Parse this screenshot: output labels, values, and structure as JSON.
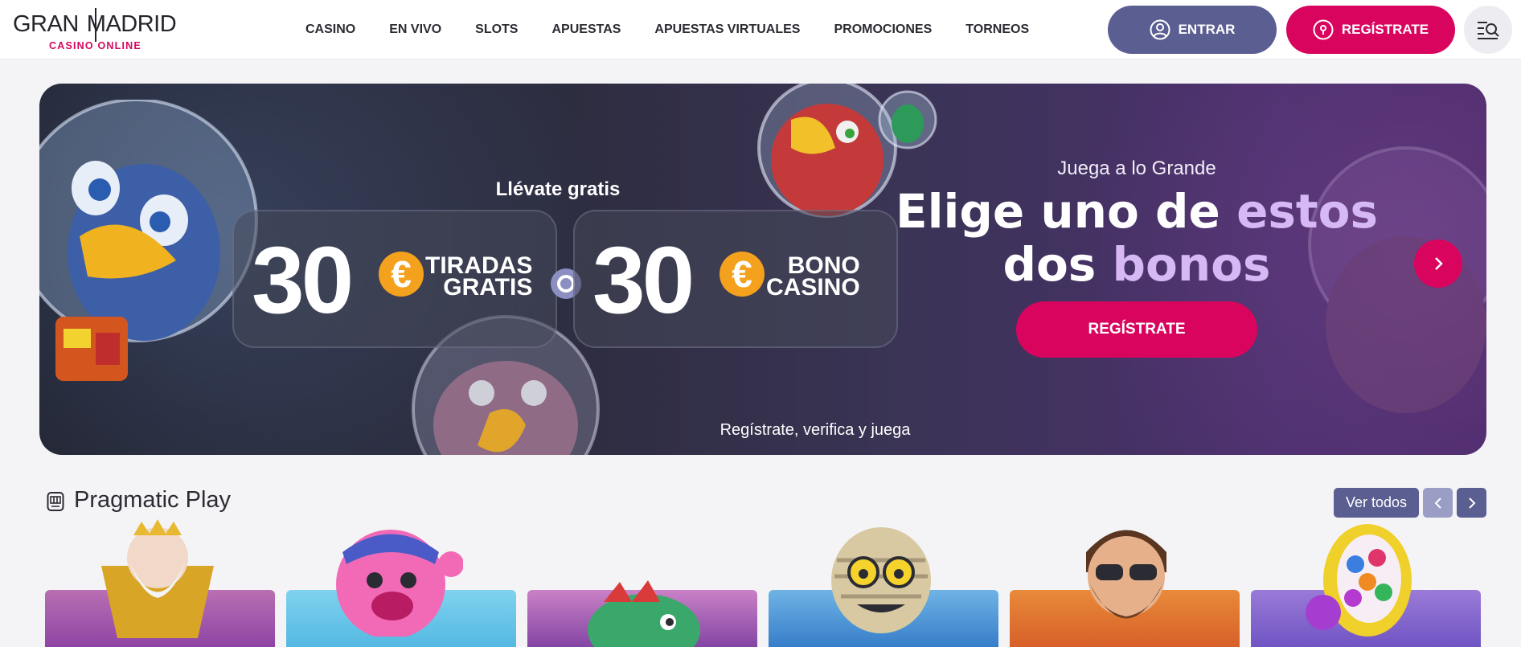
{
  "brand": {
    "name_left": "GRAN",
    "name_right": "MADRID",
    "tagline": "CASINO ONLINE",
    "accent": "#d9045e",
    "secondary": "#5a5e91"
  },
  "nav": {
    "items": [
      {
        "label": "CASINO"
      },
      {
        "label": "EN VIVO"
      },
      {
        "label": "SLOTS"
      },
      {
        "label": "APUESTAS"
      },
      {
        "label": "APUESTAS VIRTUALES"
      },
      {
        "label": "PROMOCIONES"
      },
      {
        "label": "TORNEOS"
      }
    ]
  },
  "header_actions": {
    "login_label": "ENTRAR",
    "login_icon": "user-circle-icon",
    "register_label": "REGÍSTRATE",
    "register_icon": "location-pin-icon",
    "menu_icon": "menu-search-icon"
  },
  "banner": {
    "bonus_heading": "Llévate gratis",
    "offers": [
      {
        "amount": "30",
        "currency": "€",
        "line1": "TIRADAS",
        "line2": "GRATIS"
      },
      {
        "amount": "30",
        "currency": "€",
        "line1": "BONO",
        "line2": "CASINO"
      }
    ],
    "kicker": "Juega a lo Grande",
    "title_part1": "Elige uno de ",
    "title_highlight1": "estos",
    "title_part2": "dos ",
    "title_highlight2": "bonos",
    "cta_label": "REGÍSTRATE",
    "footer_text": "Regístrate, verifica y juega",
    "next_icon": "chevron-right-icon"
  },
  "provider_section": {
    "icon": "slot-machine-icon",
    "title": "Pragmatic Play",
    "see_all_label": "Ver todos",
    "prev_icon": "chevron-left-icon",
    "next_icon": "chevron-right-icon",
    "games": [
      {
        "art": "zeus-character"
      },
      {
        "art": "pink-bear-character"
      },
      {
        "art": "fish-character"
      },
      {
        "art": "mummy-character"
      },
      {
        "art": "bearded-man-character"
      },
      {
        "art": "gumball-machine-character"
      }
    ]
  }
}
